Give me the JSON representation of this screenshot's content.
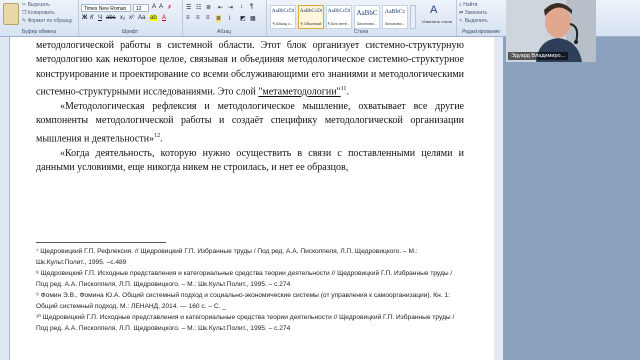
{
  "clipboard": {
    "cut": "Вырезать",
    "copy": "Копировать",
    "format_painter": "Формат по образцу",
    "group_label": "Буфер обмена"
  },
  "font": {
    "name": "Times New Roman",
    "size": "12",
    "group_label": "Шрифт"
  },
  "paragraph": {
    "group_label": "Абзац"
  },
  "styles": {
    "items": [
      {
        "sample": "AaBbCcDt",
        "name": "¶ Абзац с..."
      },
      {
        "sample": "AaBbCcDt",
        "name": "¶ Обычный"
      },
      {
        "sample": "AaBbCcDt",
        "name": "¶ Без инте..."
      },
      {
        "sample": "AaBbC",
        "name": "Заголово..."
      },
      {
        "sample": "AaBbCc",
        "name": "Заголово..."
      }
    ],
    "change_styles": "Изменить стили",
    "group_label": "Стили"
  },
  "editing": {
    "find": "Найти",
    "replace": "Заменить",
    "select": "Выделить",
    "group_label": "Редактирование"
  },
  "webcam": {
    "name": "Эдуард Владимиро..."
  },
  "document": {
    "p1_a": "методологической работы в системной области. Этот блок организует системно-структурную методологию как некоторое целое, связывая и объединяя методологическое системно-структурное конструирование и проектирование со всеми обслуживающими его знаниями и методологическими системно-структурными исследованиями. Это слой ",
    "p1_term": "\"метаметодологии\"",
    "p1_sup": "11",
    "p2": "«Методологическая рефлексия и методологическое мышление, охватывает все другие компоненты методологической работы и создаёт специфику методологической организации мышления и деятельности»",
    "p2_sup": "12",
    "p3": "«Когда деятельность, которую нужно осуществить в связи с поставленными целями и данными условиями, еще никогда никем не строилась, и нет ее образцов,"
  },
  "footnotes": [
    "⁷ Щедровицкий Г.П. Рефлексия. // Щедровицкий Г.П. Избранные труды / Под ред. А.А. Пископпеля, Л.П. Щедровицкого. – М.: Шк.Культ.Полит., 1995. –с.489",
    "⁸ Щедровицкий Г.П. Исходные представления и категориальные средства теории деятельности // Щедровицкий Г.П. Избранные труды / Под ред. А.А. Пископпеля, Л.П. Щедровицкого. – М.: Шк.Культ.Полит., 1995. – с.274",
    "⁹ Фомин Э.В., Фомина Ю.А. Общий системный подход и социально-экономические системы (от управления к самоорганизации). Кн. 1: Общий системный подход. М.: ЛЕНАНД, 2014. — 160 с. – С. _",
    "¹⁰ Щедровицкий Г.П. Исходные представления и категориальные средства теории деятельности // Щедровицкий Г.П. Избранные труды / Под ред. А.А. Пископпеля, Л.П. Щедровицкого. – М.: Шк.Культ.Полит., 1995. – с.274"
  ]
}
